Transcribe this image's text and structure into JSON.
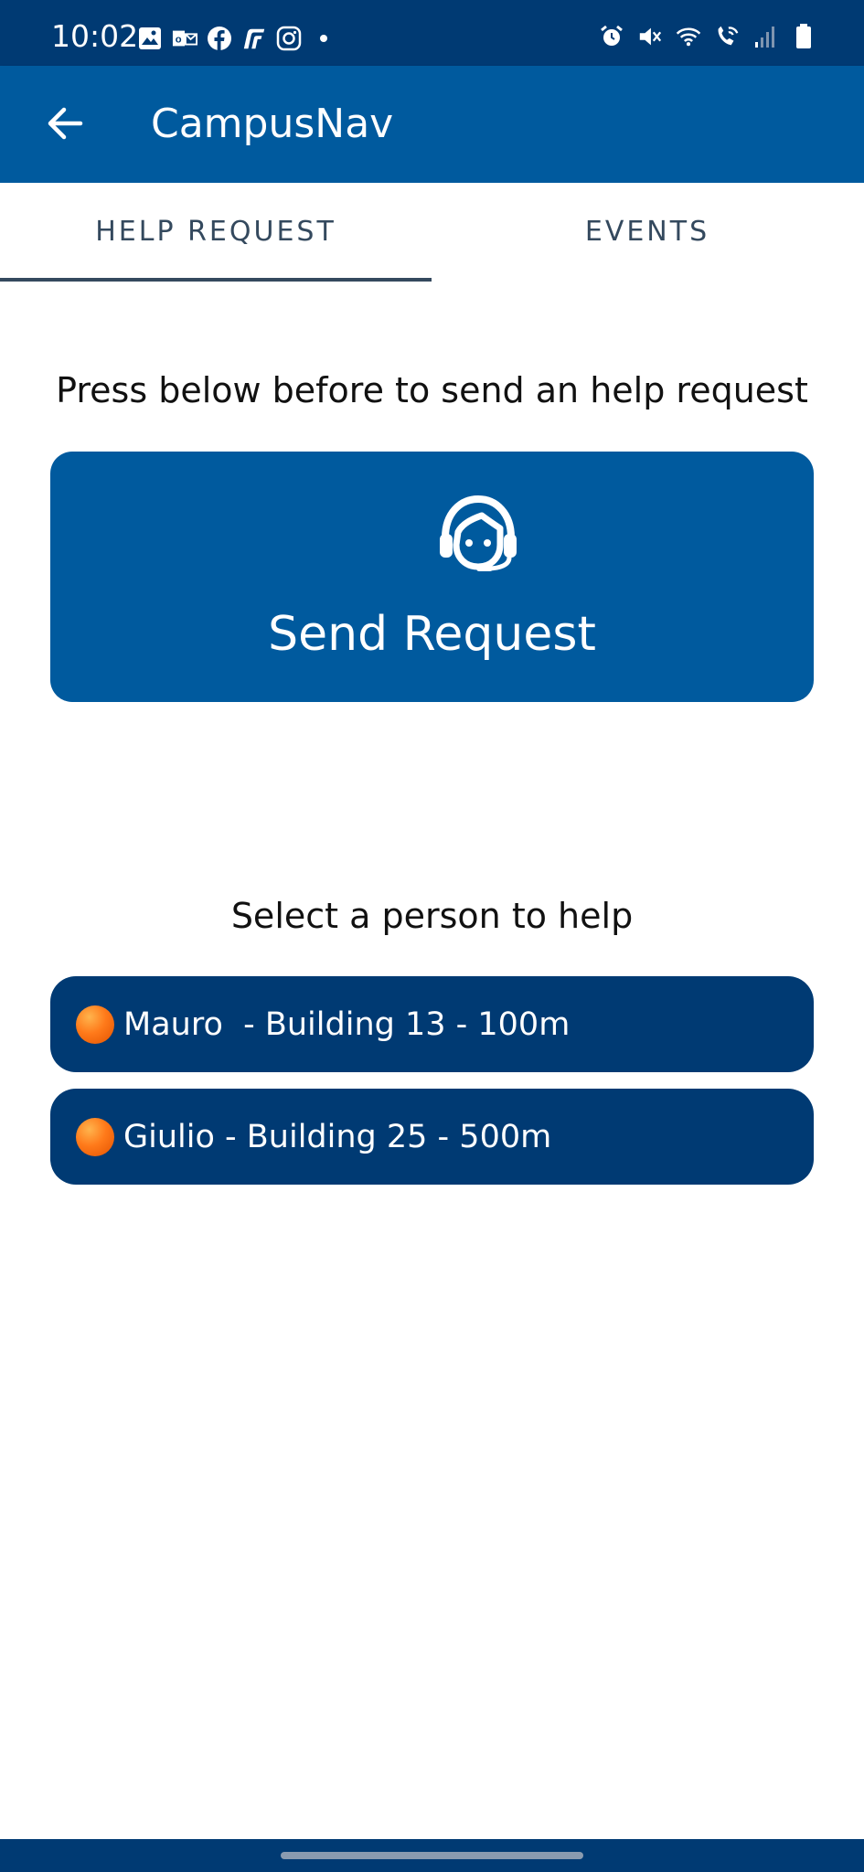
{
  "status_bar": {
    "time": "10:02",
    "left_icons": [
      "gallery-icon",
      "outlook-icon",
      "facebook-icon",
      "trenitalia-icon",
      "instagram-icon",
      "dot-icon"
    ],
    "right_icons": [
      "alarm-icon",
      "mute-icon",
      "wifi-icon",
      "wifi-call-icon",
      "signal-icon",
      "battery-icon"
    ]
  },
  "app_bar": {
    "title": "CampusNav",
    "back_icon": "arrow-left-icon"
  },
  "tabs": [
    {
      "label": "HELP REQUEST",
      "active": true
    },
    {
      "label": "EVENTS",
      "active": false
    }
  ],
  "help": {
    "instruction": "Press below before to send an help request",
    "send_button_label": "Send Request",
    "send_button_icon": "headset-agent-icon",
    "select_label": "Select a person to help",
    "people": [
      {
        "label": "Mauro  - Building 13 - 100m",
        "status_color": "#ff7a1a"
      },
      {
        "label": "Giulio - Building 25 - 500m",
        "status_color": "#ff7a1a"
      }
    ]
  },
  "colors": {
    "primary": "#005a9e",
    "primary_dark": "#003a73",
    "tab_text": "#34495e"
  }
}
